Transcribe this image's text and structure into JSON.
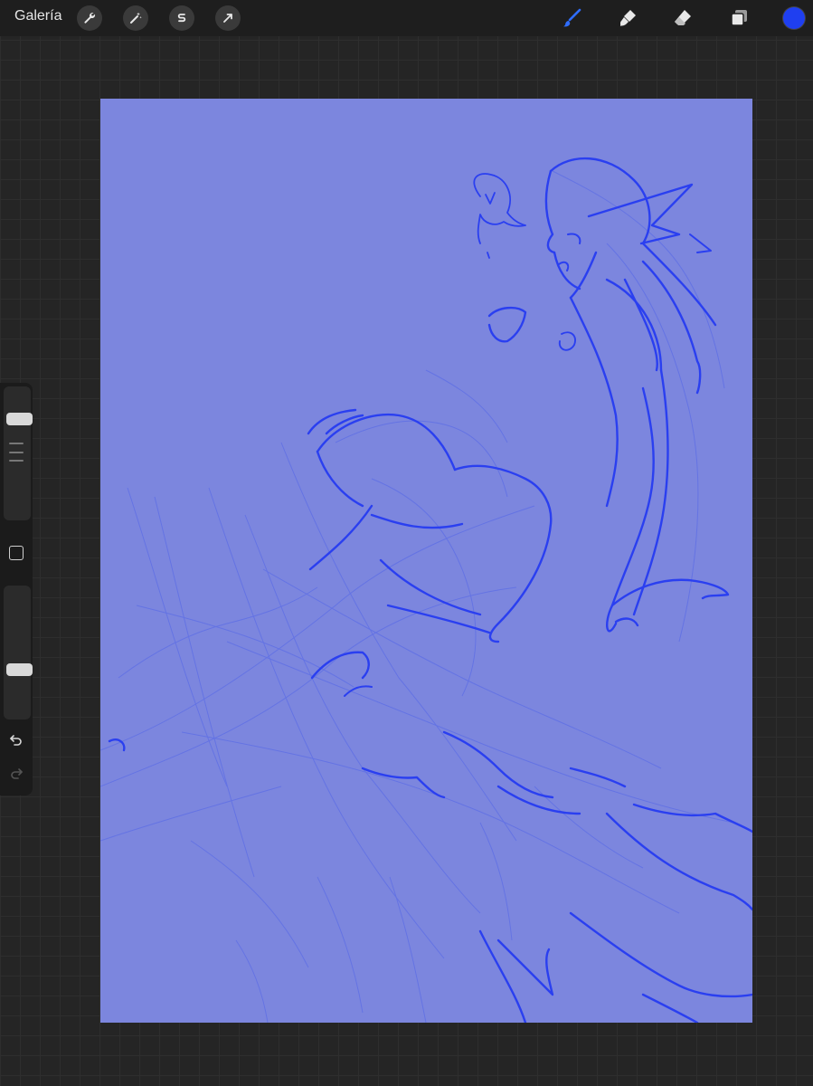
{
  "topbar": {
    "gallery_label": "Galería",
    "left_tools": [
      "wrench-icon",
      "magic-wand-icon",
      "selection-s-icon",
      "transform-arrow-icon"
    ],
    "right_tools": [
      "brush-icon",
      "smudge-icon",
      "eraser-icon",
      "layers-icon"
    ],
    "active_tool": "brush-icon",
    "current_color": "#1f3ff0"
  },
  "sidebar": {
    "brush_size_slider": 0.8,
    "opacity_slider": 0.35,
    "icons": [
      "modify-square-icon",
      "undo-icon",
      "redo-icon"
    ]
  },
  "canvas": {
    "background_color": "#7c86de",
    "sketch_color": "#2a3ff0",
    "rough_sketch_color": "#5b6ce6"
  }
}
